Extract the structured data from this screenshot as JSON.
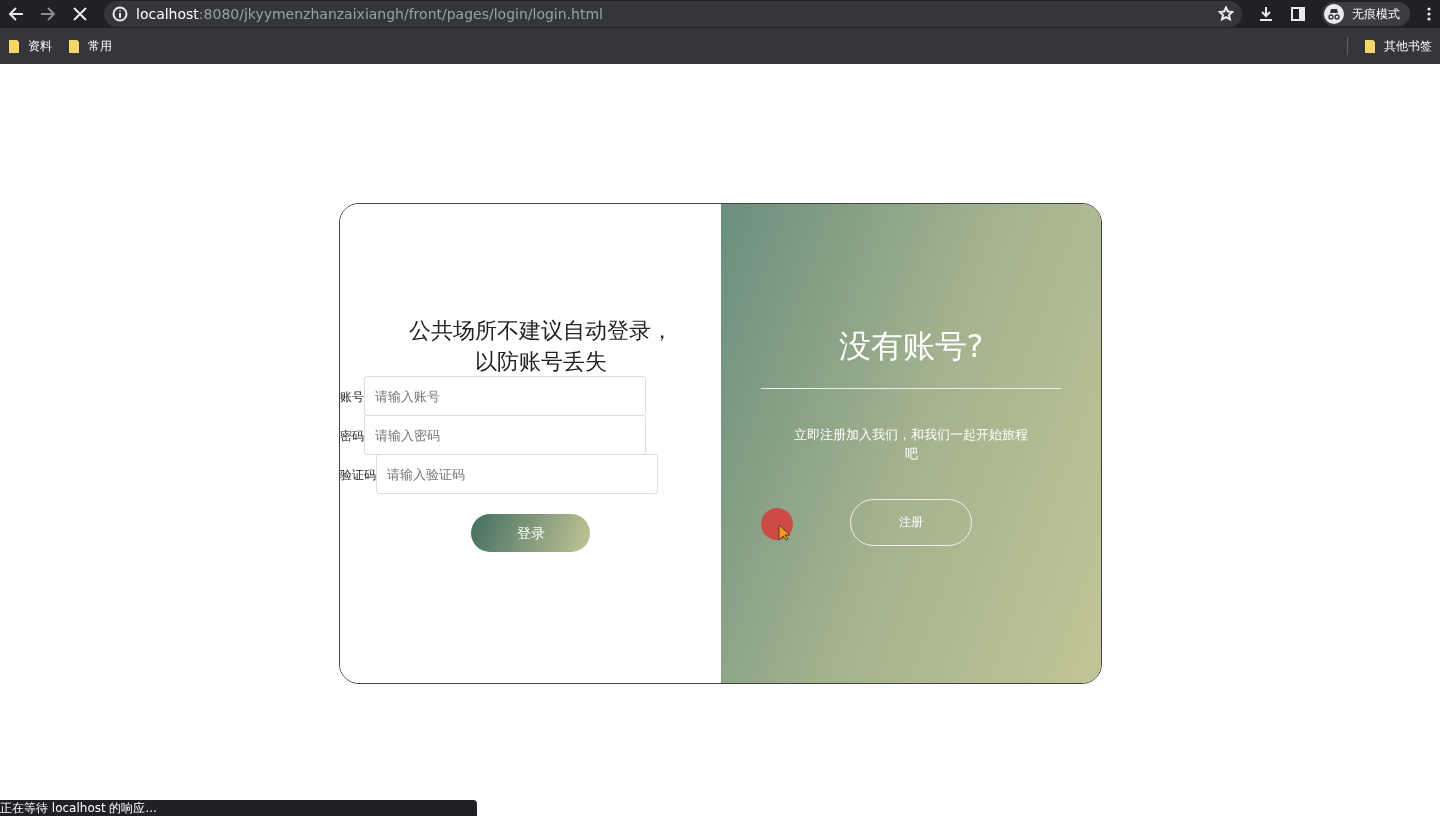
{
  "browser": {
    "loading": true,
    "url_host": "localhost",
    "url_rest": ":8080/jkyymenzhanzaixiangh/front/pages/login/login.html",
    "profile_label": "无痕模式",
    "bookmarks": [
      "资料",
      "常用"
    ],
    "other_bookmarks": "其他书签"
  },
  "login": {
    "title": "公共场所不建议自动登录，以防账号丢失",
    "fields": [
      {
        "label": "账号",
        "placeholder": "请输入账号"
      },
      {
        "label": "密码",
        "placeholder": "请输入密码"
      },
      {
        "label": "验证码",
        "placeholder": "请输入验证码"
      }
    ],
    "button": "登录"
  },
  "signup": {
    "title": "没有账号?",
    "text": "立即注册加入我们，和我们一起开始旅程吧",
    "button": "注册"
  },
  "status_bar": "正在等待 localhost 的响应..."
}
